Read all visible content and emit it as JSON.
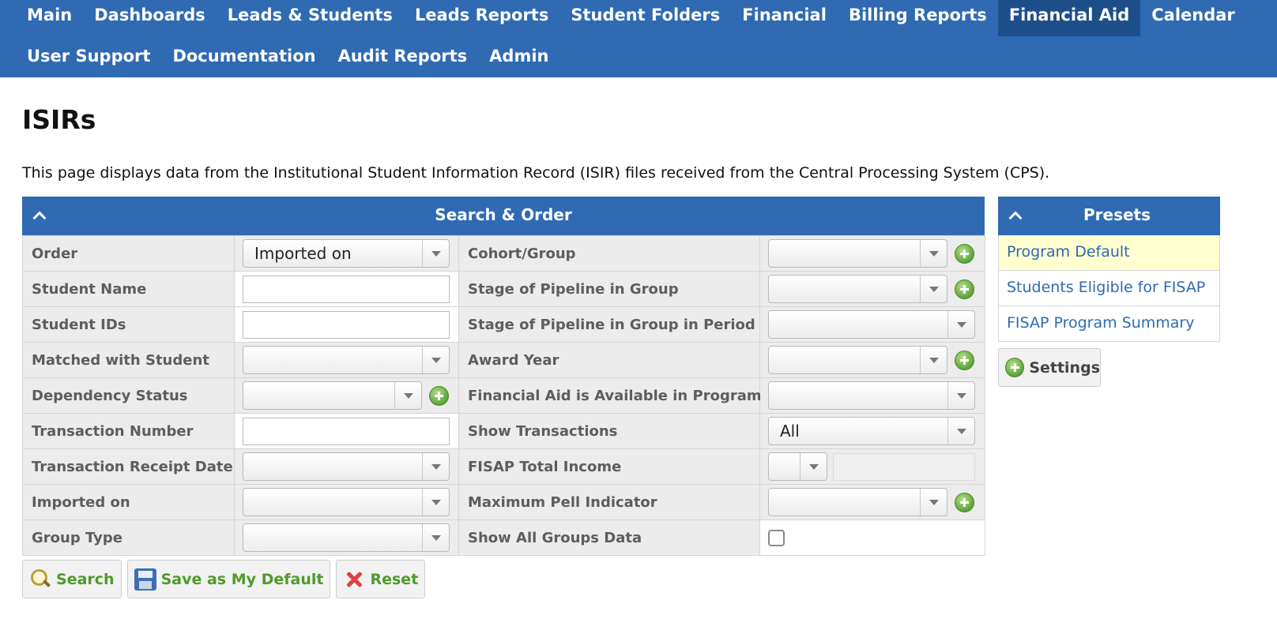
{
  "nav": {
    "row1": [
      "Main",
      "Dashboards",
      "Leads & Students",
      "Leads Reports",
      "Student Folders",
      "Financial",
      "Billing Reports",
      "Financial Aid",
      "Calendar"
    ],
    "row2": [
      "User Support",
      "Documentation",
      "Audit Reports",
      "Admin"
    ],
    "active": "Financial Aid"
  },
  "page": {
    "title": "ISIRs",
    "description": "This page displays data from the Institutional Student Information Record (ISIR) files received from the Central Processing System (CPS)."
  },
  "search_panel": {
    "title": "Search & Order",
    "left_fields": [
      {
        "label": "Order",
        "type": "select",
        "value": "Imported on"
      },
      {
        "label": "Student Name",
        "type": "text",
        "value": ""
      },
      {
        "label": "Student IDs",
        "type": "text",
        "value": ""
      },
      {
        "label": "Matched with Student",
        "type": "select",
        "value": ""
      },
      {
        "label": "Dependency Status",
        "type": "select",
        "value": "",
        "add": true
      },
      {
        "label": "Transaction Number",
        "type": "text",
        "value": ""
      },
      {
        "label": "Transaction Receipt Date",
        "type": "select",
        "value": ""
      },
      {
        "label": "Imported on",
        "type": "select",
        "value": ""
      },
      {
        "label": "Group Type",
        "type": "select",
        "value": ""
      }
    ],
    "right_fields": [
      {
        "label": "Cohort/Group",
        "type": "select",
        "value": "",
        "add": true
      },
      {
        "label": "Stage of Pipeline in Group",
        "type": "select",
        "value": "",
        "add": true
      },
      {
        "label": "Stage of Pipeline in Group in Period",
        "type": "select",
        "value": ""
      },
      {
        "label": "Award Year",
        "type": "select",
        "value": "",
        "add": true
      },
      {
        "label": "Financial Aid is Available in Program",
        "type": "select",
        "value": ""
      },
      {
        "label": "Show Transactions",
        "type": "select",
        "value": "All"
      },
      {
        "label": "FISAP Total Income",
        "type": "select-text",
        "value": ""
      },
      {
        "label": "Maximum Pell Indicator",
        "type": "select",
        "value": "",
        "add": true
      },
      {
        "label": "Show All Groups Data",
        "type": "checkbox",
        "checked": false
      }
    ]
  },
  "buttons": {
    "search": "Search",
    "save_default": "Save as My Default",
    "reset": "Reset"
  },
  "presets": {
    "title": "Presets",
    "items": [
      "Program Default",
      "Students Eligible for FISAP",
      "FISAP Program Summary"
    ],
    "highlighted_index": 0,
    "settings_label": "Settings"
  },
  "colors": {
    "nav_bg": "#2f6ab3",
    "nav_active": "#1f4f8a",
    "link": "#2f6ab3",
    "button_text": "#4e9a2a",
    "preset_highlight": "#ffffd0"
  }
}
